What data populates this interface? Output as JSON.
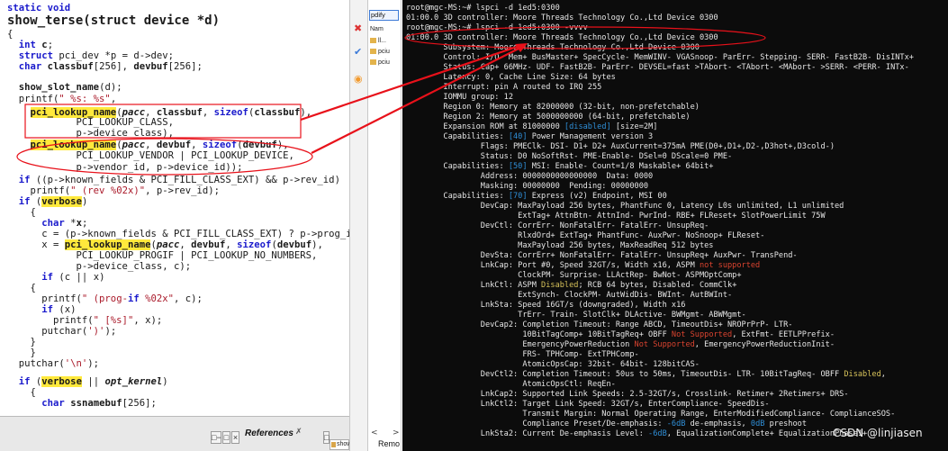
{
  "editor": {
    "lines": [
      "static void",
      "show_terse(struct device *d)",
      "{",
      "  int c;",
      "  struct pci_dev *p = d->dev;",
      "  char classbuf[256], devbuf[256];",
      "",
      "  show_slot_name(d);",
      "  printf(\" %s: %s\",",
      "    pci_lookup_name(pacc, classbuf, sizeof(classbuf),",
      "            PCI_LOOKUP_CLASS,",
      "            p->device_class),",
      "    pci_lookup_name(pacc, devbuf, sizeof(devbuf),",
      "            PCI_LOOKUP_VENDOR | PCI_LOOKUP_DEVICE,",
      "            p->vendor_id, p->device_id));",
      "  if ((p->known_fields & PCI_FILL_CLASS_EXT) && p->rev_id)",
      "    printf(\" (rev %02x)\", p->rev_id);",
      "  if (verbose)",
      "    {",
      "      char *x;",
      "      c = (p->known_fields & PCI_FILL_CLASS_EXT) ? p->prog_if",
      "      x = pci_lookup_name(pacc, devbuf, sizeof(devbuf),",
      "            PCI_LOOKUP_PROGIF | PCI_LOOKUP_NO_NUMBERS,",
      "            p->device_class, c);",
      "      if (c || x)",
      "    {",
      "      printf(\" (prog-if %02x\", c);",
      "      if (x)",
      "        printf(\" [%s]\", x);",
      "      putchar(')');",
      "    }",
      "    }",
      "  putchar('\\n');",
      "",
      "  if (verbose || opt_kernel)",
      "    {",
      "      char ssnamebuf[256];"
    ]
  },
  "statusbar": {
    "references_label": "References",
    "references_close": "✗",
    "show_tab": "show",
    "mini_buttons": [
      "□−",
      "□",
      "×",
      "□"
    ]
  },
  "explorer": {
    "input_value": "pdify",
    "items": [
      "Nam",
      "ll...",
      "pciu",
      "pciu"
    ],
    "nav_left": "<",
    "nav_right": ">",
    "bottom_label": "Remo"
  },
  "terminal": {
    "lines": [
      "root@mgc-MS:~# lspci -d 1ed5:0300",
      "01:00.0 3D controller: Moore Threads Technology Co.,Ltd Device 0300",
      "root@mgc-MS:~# lspci -d 1ed5:0300 -vvvv",
      "01:00.0 3D controller: Moore Threads Technology Co.,Ltd Device 0300",
      "        Subsystem: Moore Threads Technology Co.,Ltd Device 0300",
      "        Control: I/O- Mem+ BusMaster+ SpecCycle- MemWINV- VGASnoop- ParErr- Stepping- SERR- FastB2B- DisINTx+",
      "        Status: Cap+ 66MHz- UDF- FastB2B- ParErr- DEVSEL=fast >TAbort- <TAbort- <MAbort- >SERR- <PERR- INTx-",
      "        Latency: 0, Cache Line Size: 64 bytes",
      "        Interrupt: pin A routed to IRQ 255",
      "        IOMMU group: 12",
      "        Region 0: Memory at 82000000 (32-bit, non-prefetchable)",
      "        Region 2: Memory at 5000000000 (64-bit, prefetchable)",
      "        Expansion ROM at 81000000 [disabled] [size=2M]",
      "        Capabilities: [40] Power Management version 3",
      "                Flags: PMEClk- DSI- D1+ D2+ AuxCurrent=375mA PME(D0+,D1+,D2-,D3hot+,D3cold-)",
      "                Status: D0 NoSoftRst- PME-Enable- DSel=0 DScale=0 PME-",
      "        Capabilities: [50] MSI: Enable- Count=1/8 Maskable+ 64bit+",
      "                Address: 0000000000000000  Data: 0000",
      "                Masking: 00000000  Pending: 00000000",
      "        Capabilities: [70] Express (v2) Endpoint, MSI 00",
      "                DevCap: MaxPayload 256 bytes, PhantFunc 0, Latency L0s unlimited, L1 unlimited",
      "                        ExtTag+ AttnBtn- AttnInd- PwrInd- RBE+ FLReset+ SlotPowerLimit 75W",
      "                DevCtl: CorrErr- NonFatalErr- FatalErr- UnsupReq-",
      "                        RlxdOrd+ ExtTag+ PhantFunc- AuxPwr- NoSnoop+ FLReset-",
      "                        MaxPayload 256 bytes, MaxReadReq 512 bytes",
      "                DevSta: CorrErr+ NonFatalErr- FatalErr- UnsupReq+ AuxPwr- TransPend-",
      "                LnkCap: Port #0, Speed 32GT/s, Width x16, ASPM not supported",
      "                        ClockPM- Surprise- LLActRep- BwNot- ASPMOptComp+",
      "                LnkCtl: ASPM Disabled; RCB 64 bytes, Disabled- CommClk+",
      "                        ExtSynch- ClockPM- AutWidDis- BWInt- AutBWInt-",
      "                LnkSta: Speed 16GT/s (downgraded), Width x16",
      "                        TrErr- Train- SlotClk+ DLActive- BWMgmt- ABWMgmt-",
      "                DevCap2: Completion Timeout: Range ABCD, TimeoutDis+ NROPrPrP- LTR-",
      "                         10BitTagComp+ 10BitTagReq+ OBFF Not Supported, ExtFmt- EETLPPrefix-",
      "                         EmergencyPowerReduction Not Supported, EmergencyPowerReductionInit-",
      "                         FRS- TPHComp- ExtTPHComp-",
      "                         AtomicOpsCap: 32bit- 64bit- 128bitCAS-",
      "                DevCtl2: Completion Timeout: 50us to 50ms, TimeoutDis- LTR- 10BitTagReq- OBFF Disabled,",
      "                         AtomicOpsCtl: ReqEn-",
      "                LnkCap2: Supported Link Speeds: 2.5-32GT/s, Crosslink- Retimer+ 2Retimers+ DRS-",
      "                LnkCtl2: Target Link Speed: 32GT/s, EnterCompliance- SpeedDis-",
      "                         Transmit Margin: Normal Operating Range, EnterModifiedCompliance- ComplianceSOS-",
      "                         Compliance Preset/De-emphasis: -6dB de-emphasis, 0dB preshoot",
      "                LnkSta2: Current De-emphasis Level: -6dB, EqualizationComplete+ EqualizationPhase1+"
    ],
    "watermark": "CSDN @linjiasen"
  },
  "colors": {
    "terminal_bg": "#0c0c0c",
    "terminal_fg": "#e6e6e6",
    "capability_blue": "#2f8fd8",
    "warning_red": "#d9432f",
    "disabled_yellow": "#d7c25a",
    "highlight_yellow": "#ffe93c",
    "keyword_blue": "#1a1acc",
    "string_red": "#aa1a2a",
    "annotation_red": "#e8111a"
  },
  "icons": [
    "close-icon",
    "folder-icon",
    "link-icon",
    "gear-icon",
    "arrow-left-icon",
    "arrow-right-icon"
  ]
}
